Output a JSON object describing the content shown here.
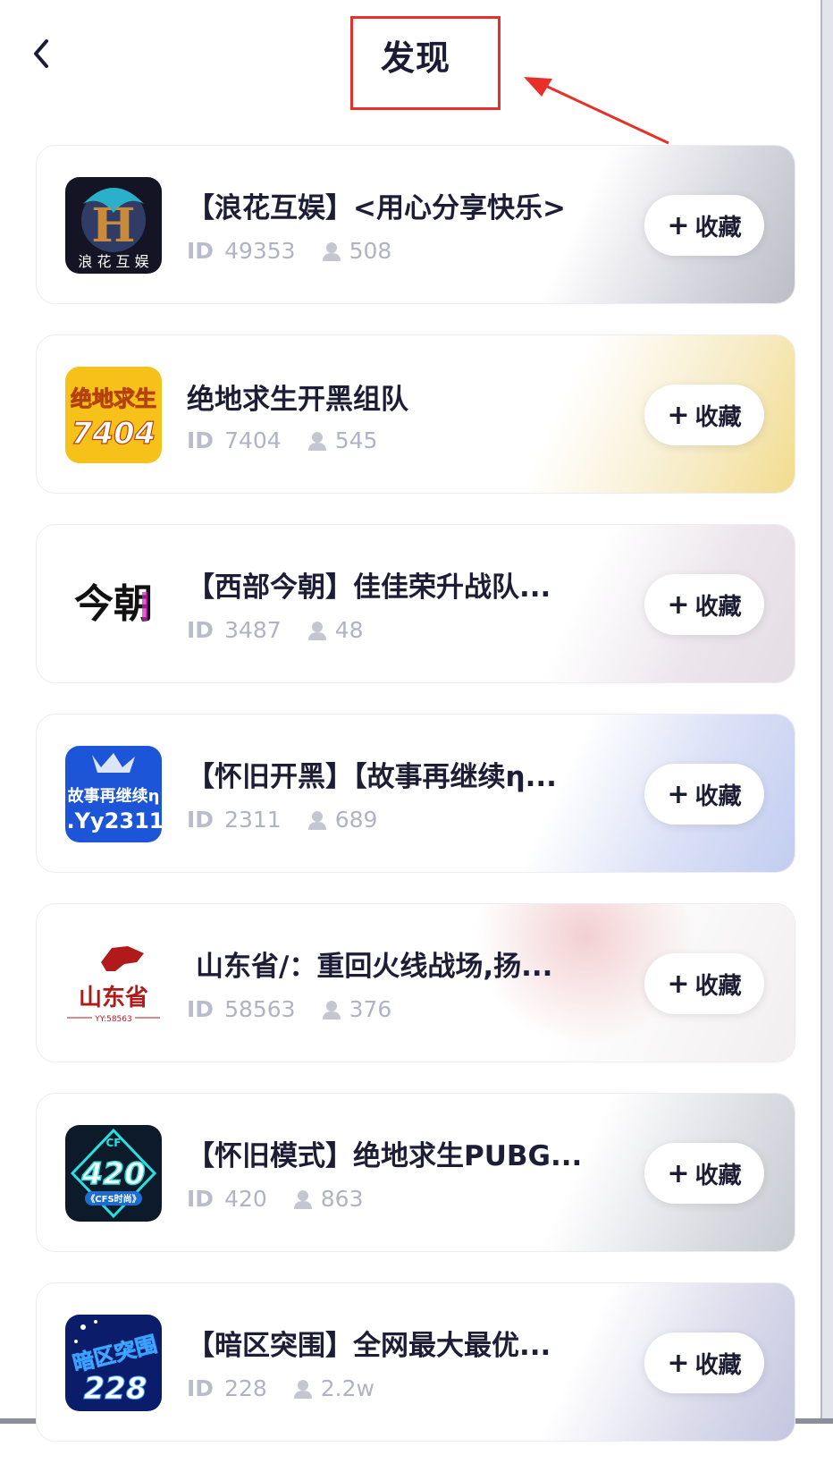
{
  "header": {
    "title": "发现",
    "back_icon": "chevron-left-icon"
  },
  "favorite_label": "收藏",
  "favorite_icon": "plus-icon",
  "id_label": "ID",
  "member_icon": "user-icon",
  "items": [
    {
      "title": "【浪花互娱】<用心分享快乐>",
      "id": "49353",
      "members": "508",
      "avatar_text": "浪花互娱",
      "bg": "#bdbdc8"
    },
    {
      "title": "绝地求生开黑组队",
      "id": "7404",
      "members": "545",
      "avatar_text": "绝地求生7404",
      "bg": "#f2dc8e"
    },
    {
      "title": "【西部今朝】佳佳荣升战队...",
      "id": "3487",
      "members": "48",
      "avatar_text": "今朝",
      "bg": "#e4dde4"
    },
    {
      "title": "【怀旧开黑】【故事再继续η...",
      "id": "2311",
      "members": "689",
      "avatar_text": "故事再继续η .Yy2311",
      "bg": "#c2cdf0"
    },
    {
      "title": "山东省/：重回火线战场,扬...",
      "id": "58563",
      "members": "376",
      "avatar_text": "山东省 YY:58563",
      "bg": "#f2d0d2"
    },
    {
      "title": "【怀旧模式】绝地求生PUBG...",
      "id": "420",
      "members": "863",
      "avatar_text": "CF 420 《CFS时尚》",
      "bg": "#c8cad2"
    },
    {
      "title": "【暗区突围】全网最大最优...",
      "id": "228",
      "members": "2.2w",
      "avatar_text": "暗区突围228",
      "bg": "#c4c6e0"
    }
  ]
}
